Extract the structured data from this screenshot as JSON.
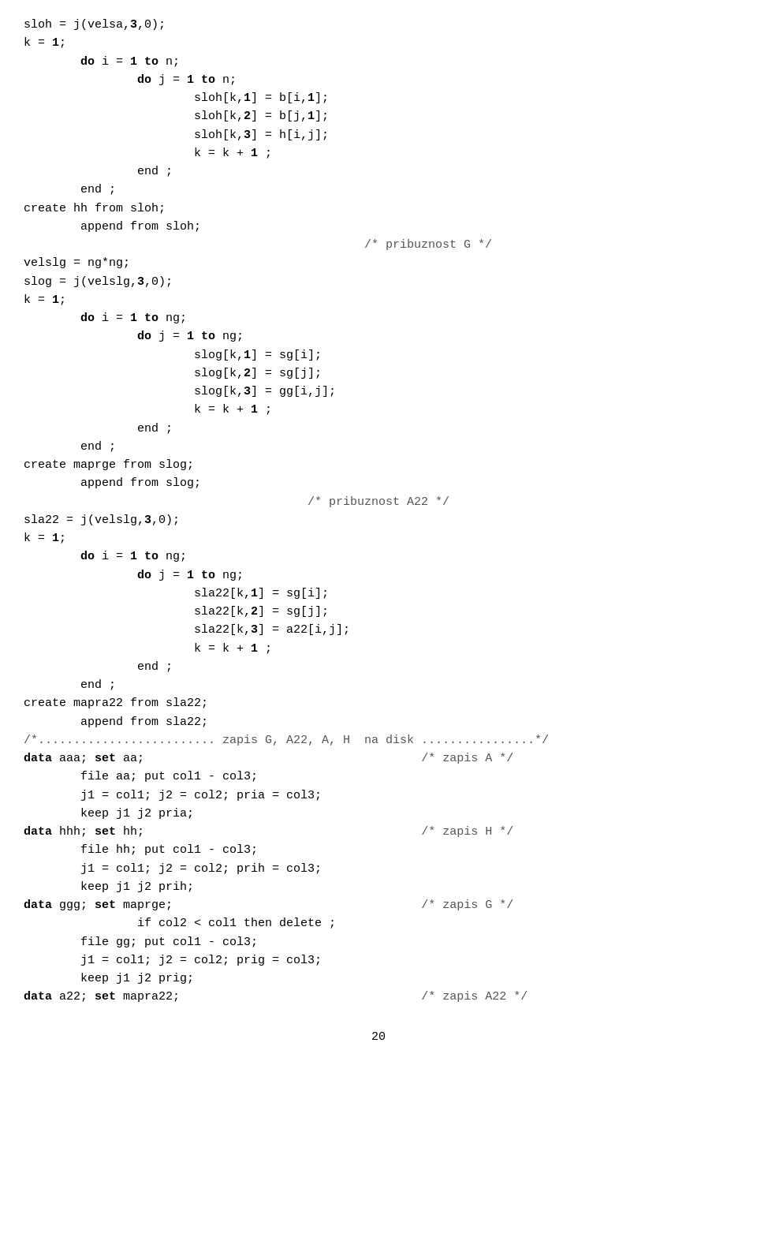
{
  "page": {
    "number": "20"
  },
  "code": {
    "lines": [
      "sloh = j(velsa,3,0);",
      "k = 1;",
      "        do i = 1 to n;",
      "                do j = 1 to n;",
      "                        sloh[k,1] = b[i,1];",
      "                        sloh[k,2] = b[j,1];",
      "                        sloh[k,3] = h[i,j];",
      "                        k = k + 1 ;",
      "                end ;",
      "        end ;",
      "create hh from sloh;",
      "        append from sloh;",
      "                                                /* pribuznost G */",
      "velslg = ng*ng;",
      "slog = j(velslg,3,0);",
      "k = 1;",
      "        do i = 1 to ng;",
      "                do j = 1 to ng;",
      "                        slog[k,1] = sg[i];",
      "                        slog[k,2] = sg[j];",
      "                        slog[k,3] = gg[i,j];",
      "                        k = k + 1 ;",
      "                end ;",
      "        end ;",
      "create maprge from slog;",
      "        append from slog;",
      "                                        /* pribuznost A22 */",
      "sla22 = j(velslg,3,0);",
      "k = 1;",
      "        do i = 1 to ng;",
      "                do j = 1 to ng;",
      "                        sla22[k,1] = sg[i];",
      "                        sla22[k,2] = sg[j];",
      "                        sla22[k,3] = a22[i,j];",
      "                        k = k + 1 ;",
      "                end ;",
      "        end ;",
      "create mapra22 from sla22;",
      "        append from sla22;",
      "/*......................... zapis G, A22, A, H  na disk ................*/",
      "data aaa; set aa;                                       /* zapis A */",
      "        file aa; put col1 - col3;",
      "        j1 = col1; j2 = col2; pria = col3;",
      "        keep j1 j2 pria;",
      "data hhh; set hh;                                       /* zapis H */",
      "        file hh; put col1 - col3;",
      "        j1 = col1; j2 = col2; prih = col3;",
      "        keep j1 j2 prih;",
      "data ggg; set maprge;                                   /* zapis G */",
      "                if col2 < col1 then delete ;",
      "        file gg; put col1 - col3;",
      "        j1 = col1; j2 = col2; prig = col3;",
      "        keep j1 j2 prig;",
      "data a22; set mapra22;                                  /* zapis A22 */"
    ]
  }
}
